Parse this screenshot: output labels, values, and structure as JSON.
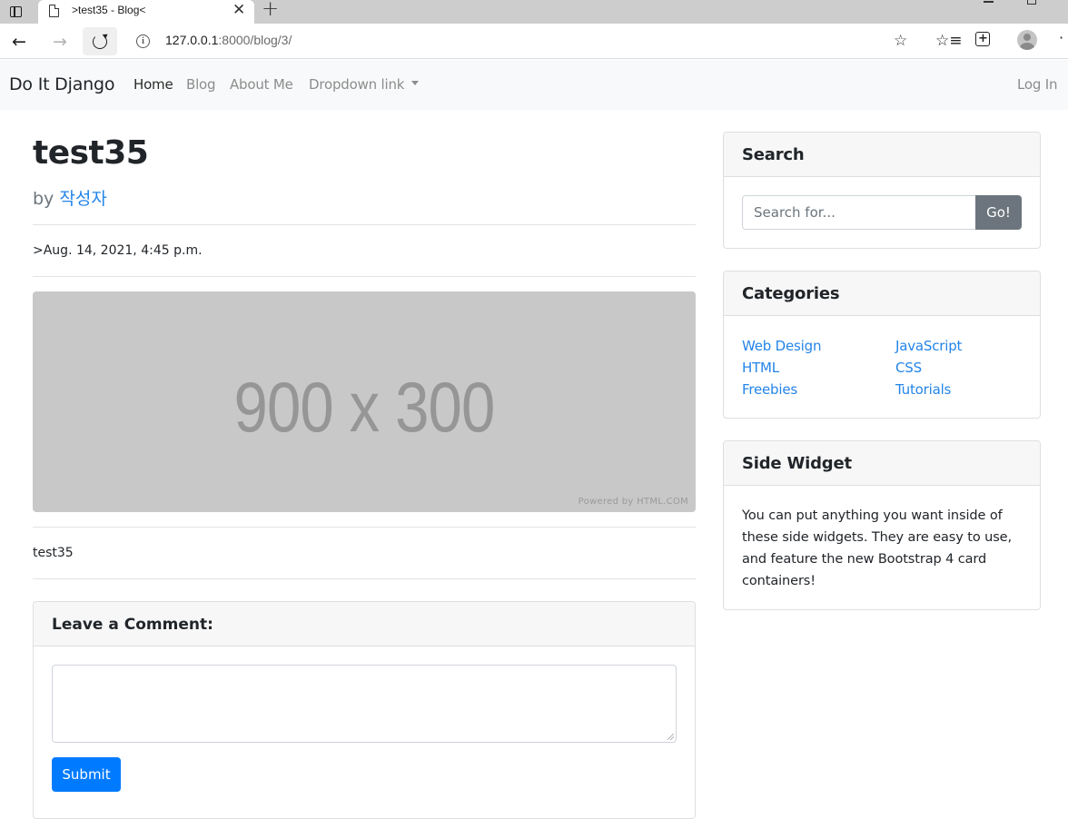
{
  "browser": {
    "tab_title": ">test35 - Blog<",
    "tab_close": "✕",
    "new_tab": "+",
    "url_host": "127.0.0.1",
    "url_rest": ":8000/blog/3/"
  },
  "navbar": {
    "brand": "Do It Django",
    "links": [
      "Home",
      "Blog",
      "About Me",
      "Dropdown link"
    ],
    "login": "Log In"
  },
  "post": {
    "title": "test35",
    "by_label": "by",
    "author": "작성자",
    "date": ">Aug. 14, 2021, 4:45 p.m.",
    "image_text": "900 x 300",
    "image_credit": "Powered by HTML.COM",
    "body": "test35"
  },
  "comment": {
    "heading": "Leave a Comment:",
    "submit_label": "Submit"
  },
  "sidebar": {
    "search": {
      "heading": "Search",
      "placeholder": "Search for...",
      "button": "Go!"
    },
    "categories": {
      "heading": "Categories",
      "items": [
        "Web Design",
        "JavaScript",
        "HTML",
        "CSS",
        "Freebies",
        "Tutorials"
      ]
    },
    "widget": {
      "heading": "Side Widget",
      "text": "You can put anything you want inside of these side widgets. They are easy to use, and feature the new Bootstrap 4 card containers!"
    }
  },
  "colors": {
    "primary": "#007bff",
    "link": "#2485e8",
    "secondary": "#6c757d",
    "navbar_bg": "#f8f9fa"
  }
}
